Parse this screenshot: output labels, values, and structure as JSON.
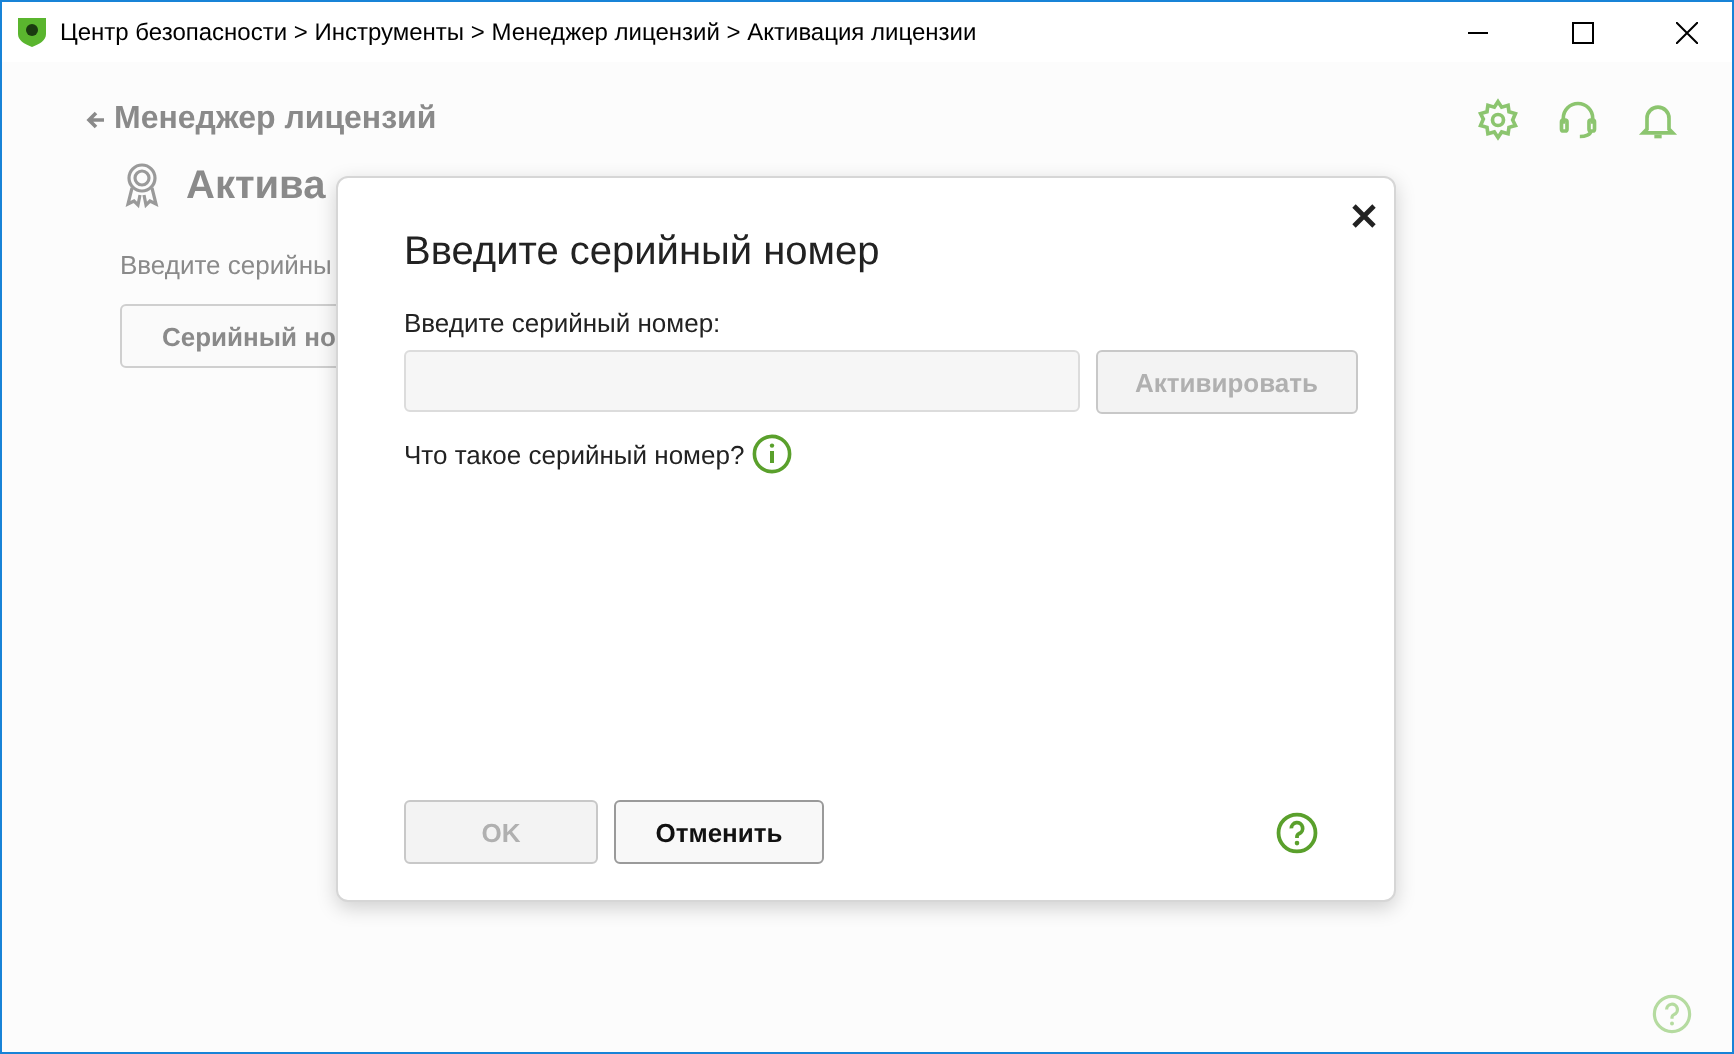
{
  "window": {
    "title": "Центр безопасности > Инструменты > Менеджер лицензий > Активация лицензии"
  },
  "page": {
    "back_link": "Менеджер лицензий",
    "heading": "Актива",
    "description": "Введите серийны",
    "serial_button": "Серийный но"
  },
  "dialog": {
    "title": "Введите серийный номер",
    "field_label": "Введите серийный номер:",
    "activate_button": {
      "label": "Активировать",
      "disabled": true
    },
    "help_link": "Что такое серийный номер?",
    "buttons": [
      {
        "label": "OK",
        "disabled": true
      },
      {
        "label": "Отменить",
        "disabled": false
      }
    ]
  }
}
